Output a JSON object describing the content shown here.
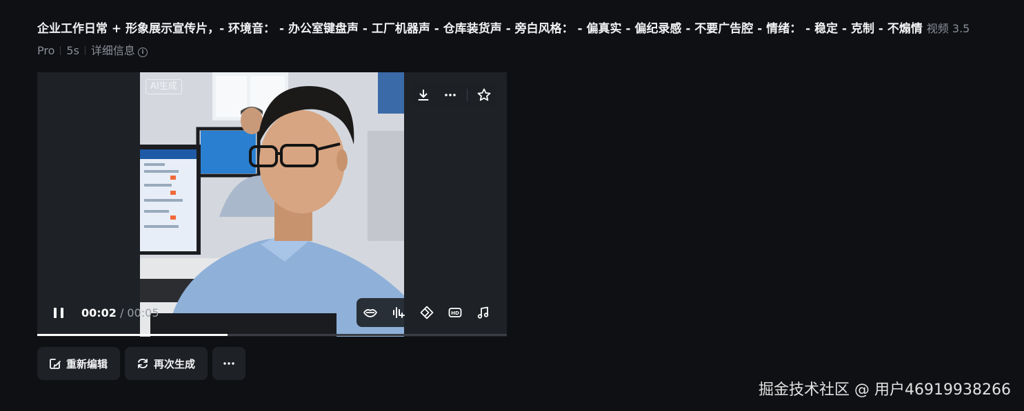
{
  "prompt": {
    "text": "企业工作日常 + 形象展示宣传片，- 环境音： - 办公室键盘声 - 工厂机器声 - 仓库装货声 - 旁白风格： - 偏真实 - 偏纪录感 - 不要广告腔 - 情绪： - 稳定 - 克制 - 不煽情",
    "model": "视频 3.5 Pro",
    "duration": "5s",
    "details_label": "详细信息"
  },
  "player": {
    "ai_badge": "AI生成",
    "current_time": "00:02",
    "total_time": "/ 00:05",
    "progress": 0.406,
    "top_tools": [
      "download-icon",
      "more-icon",
      "star-icon"
    ],
    "bottom_tools": [
      "lip-sync-icon",
      "audio-wave-icon",
      "diamond-icon",
      "hd-icon",
      "music-icon"
    ]
  },
  "actions": {
    "reedit_label": "重新编辑",
    "regenerate_label": "再次生成"
  },
  "watermark": "掘金技术社区 @ 用户46919938266"
}
